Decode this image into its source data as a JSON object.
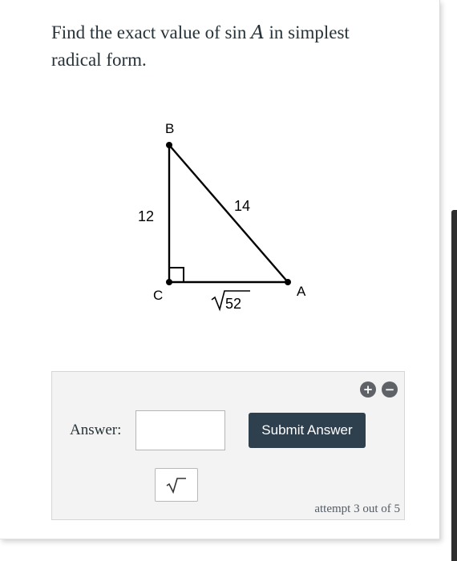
{
  "question": {
    "text_before": "Find the exact value of sin ",
    "variable": "A",
    "text_after": " in simplest radical form."
  },
  "diagram": {
    "vertices": {
      "B": "B",
      "C": "C",
      "A": "A"
    },
    "sides": {
      "bc": "12",
      "ab": "14",
      "ca_radicand": "52"
    },
    "right_angle_at": "C"
  },
  "answer_section": {
    "label": "Answer:",
    "input_value": "",
    "submit_label": "Submit Answer",
    "plus_icon": "+",
    "minus_icon": "−",
    "sqrt_icon": "square-root-icon",
    "attempt_text": "attempt 3 out of 5"
  },
  "colors": {
    "submit_bg": "#2e3f4e",
    "panel_bg": "#f3f3f3",
    "text": "#263238"
  }
}
